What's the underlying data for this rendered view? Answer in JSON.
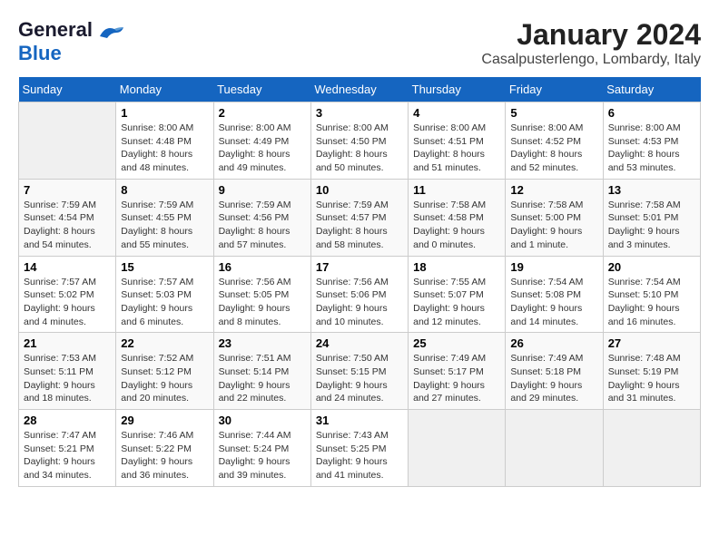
{
  "logo": {
    "line1": "General",
    "line2": "Blue"
  },
  "title": "January 2024",
  "subtitle": "Casalpusterlengo, Lombardy, Italy",
  "days_header": [
    "Sunday",
    "Monday",
    "Tuesday",
    "Wednesday",
    "Thursday",
    "Friday",
    "Saturday"
  ],
  "weeks": [
    [
      {
        "day": "",
        "content": ""
      },
      {
        "day": "1",
        "content": "Sunrise: 8:00 AM\nSunset: 4:48 PM\nDaylight: 8 hours\nand 48 minutes."
      },
      {
        "day": "2",
        "content": "Sunrise: 8:00 AM\nSunset: 4:49 PM\nDaylight: 8 hours\nand 49 minutes."
      },
      {
        "day": "3",
        "content": "Sunrise: 8:00 AM\nSunset: 4:50 PM\nDaylight: 8 hours\nand 50 minutes."
      },
      {
        "day": "4",
        "content": "Sunrise: 8:00 AM\nSunset: 4:51 PM\nDaylight: 8 hours\nand 51 minutes."
      },
      {
        "day": "5",
        "content": "Sunrise: 8:00 AM\nSunset: 4:52 PM\nDaylight: 8 hours\nand 52 minutes."
      },
      {
        "day": "6",
        "content": "Sunrise: 8:00 AM\nSunset: 4:53 PM\nDaylight: 8 hours\nand 53 minutes."
      }
    ],
    [
      {
        "day": "7",
        "content": "Sunrise: 7:59 AM\nSunset: 4:54 PM\nDaylight: 8 hours\nand 54 minutes."
      },
      {
        "day": "8",
        "content": "Sunrise: 7:59 AM\nSunset: 4:55 PM\nDaylight: 8 hours\nand 55 minutes."
      },
      {
        "day": "9",
        "content": "Sunrise: 7:59 AM\nSunset: 4:56 PM\nDaylight: 8 hours\nand 57 minutes."
      },
      {
        "day": "10",
        "content": "Sunrise: 7:59 AM\nSunset: 4:57 PM\nDaylight: 8 hours\nand 58 minutes."
      },
      {
        "day": "11",
        "content": "Sunrise: 7:58 AM\nSunset: 4:58 PM\nDaylight: 9 hours\nand 0 minutes."
      },
      {
        "day": "12",
        "content": "Sunrise: 7:58 AM\nSunset: 5:00 PM\nDaylight: 9 hours\nand 1 minute."
      },
      {
        "day": "13",
        "content": "Sunrise: 7:58 AM\nSunset: 5:01 PM\nDaylight: 9 hours\nand 3 minutes."
      }
    ],
    [
      {
        "day": "14",
        "content": "Sunrise: 7:57 AM\nSunset: 5:02 PM\nDaylight: 9 hours\nand 4 minutes."
      },
      {
        "day": "15",
        "content": "Sunrise: 7:57 AM\nSunset: 5:03 PM\nDaylight: 9 hours\nand 6 minutes."
      },
      {
        "day": "16",
        "content": "Sunrise: 7:56 AM\nSunset: 5:05 PM\nDaylight: 9 hours\nand 8 minutes."
      },
      {
        "day": "17",
        "content": "Sunrise: 7:56 AM\nSunset: 5:06 PM\nDaylight: 9 hours\nand 10 minutes."
      },
      {
        "day": "18",
        "content": "Sunrise: 7:55 AM\nSunset: 5:07 PM\nDaylight: 9 hours\nand 12 minutes."
      },
      {
        "day": "19",
        "content": "Sunrise: 7:54 AM\nSunset: 5:08 PM\nDaylight: 9 hours\nand 14 minutes."
      },
      {
        "day": "20",
        "content": "Sunrise: 7:54 AM\nSunset: 5:10 PM\nDaylight: 9 hours\nand 16 minutes."
      }
    ],
    [
      {
        "day": "21",
        "content": "Sunrise: 7:53 AM\nSunset: 5:11 PM\nDaylight: 9 hours\nand 18 minutes."
      },
      {
        "day": "22",
        "content": "Sunrise: 7:52 AM\nSunset: 5:12 PM\nDaylight: 9 hours\nand 20 minutes."
      },
      {
        "day": "23",
        "content": "Sunrise: 7:51 AM\nSunset: 5:14 PM\nDaylight: 9 hours\nand 22 minutes."
      },
      {
        "day": "24",
        "content": "Sunrise: 7:50 AM\nSunset: 5:15 PM\nDaylight: 9 hours\nand 24 minutes."
      },
      {
        "day": "25",
        "content": "Sunrise: 7:49 AM\nSunset: 5:17 PM\nDaylight: 9 hours\nand 27 minutes."
      },
      {
        "day": "26",
        "content": "Sunrise: 7:49 AM\nSunset: 5:18 PM\nDaylight: 9 hours\nand 29 minutes."
      },
      {
        "day": "27",
        "content": "Sunrise: 7:48 AM\nSunset: 5:19 PM\nDaylight: 9 hours\nand 31 minutes."
      }
    ],
    [
      {
        "day": "28",
        "content": "Sunrise: 7:47 AM\nSunset: 5:21 PM\nDaylight: 9 hours\nand 34 minutes."
      },
      {
        "day": "29",
        "content": "Sunrise: 7:46 AM\nSunset: 5:22 PM\nDaylight: 9 hours\nand 36 minutes."
      },
      {
        "day": "30",
        "content": "Sunrise: 7:44 AM\nSunset: 5:24 PM\nDaylight: 9 hours\nand 39 minutes."
      },
      {
        "day": "31",
        "content": "Sunrise: 7:43 AM\nSunset: 5:25 PM\nDaylight: 9 hours\nand 41 minutes."
      },
      {
        "day": "",
        "content": ""
      },
      {
        "day": "",
        "content": ""
      },
      {
        "day": "",
        "content": ""
      }
    ]
  ]
}
